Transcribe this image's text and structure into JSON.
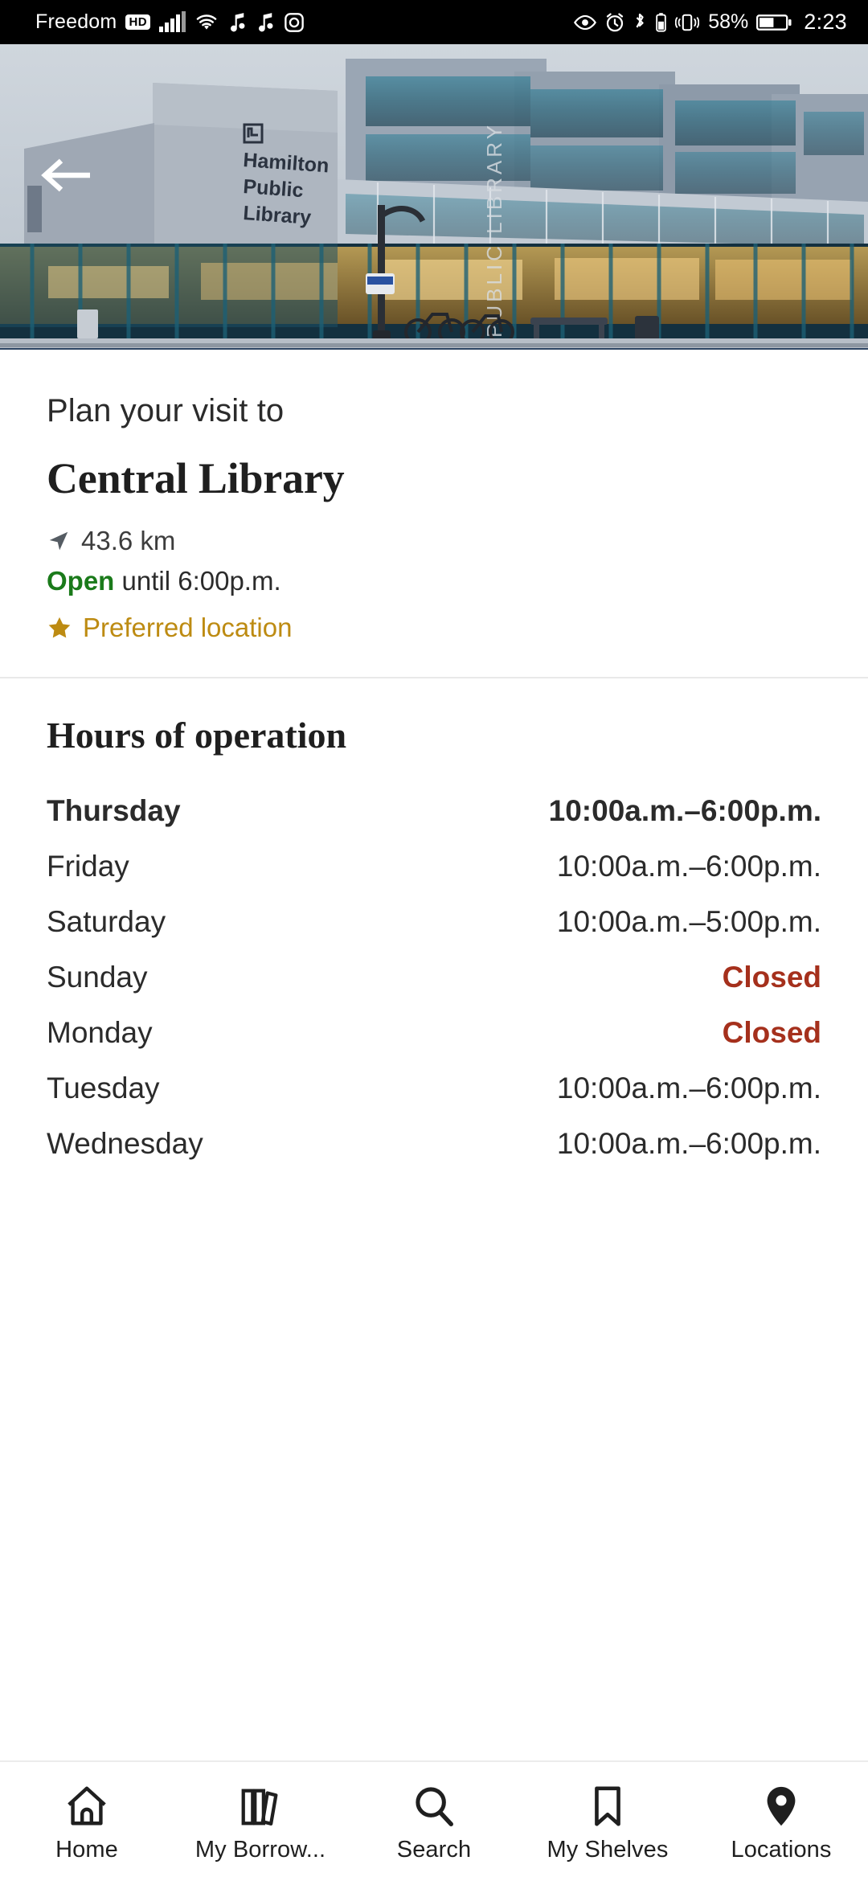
{
  "statusbar": {
    "carrier": "Freedom",
    "hd_badge": "HD",
    "battery_percent": "58%",
    "time": "2:23",
    "icons": [
      "signal-bars-icon",
      "wifi-icon",
      "music-note-icon",
      "music-note-icon",
      "instagram-icon",
      "eye-icon",
      "alarm-clock-icon",
      "bluetooth-icon",
      "vibrate-icon",
      "battery-icon"
    ]
  },
  "hero": {
    "back_icon": "back-arrow-icon",
    "building_sign": "Hamilton Public Library",
    "glass_text": "PUBLIC LIBRARY"
  },
  "info": {
    "plan_label": "Plan your visit to",
    "branch_name": "Central Library",
    "distance": "43.6 km",
    "distance_icon": "navigation-arrow-icon",
    "status_word": "Open",
    "status_rest": " until 6:00p.m.",
    "preferred_label": "Preferred location",
    "preferred_icon": "star-icon"
  },
  "hours": {
    "title": "Hours of operation",
    "rows": [
      {
        "day": "Thursday",
        "time": "10:00a.m.–6:00p.m.",
        "closed": false,
        "today": true
      },
      {
        "day": "Friday",
        "time": "10:00a.m.–6:00p.m.",
        "closed": false,
        "today": false
      },
      {
        "day": "Saturday",
        "time": "10:00a.m.–5:00p.m.",
        "closed": false,
        "today": false
      },
      {
        "day": "Sunday",
        "time": "Closed",
        "closed": true,
        "today": false
      },
      {
        "day": "Monday",
        "time": "Closed",
        "closed": true,
        "today": false
      },
      {
        "day": "Tuesday",
        "time": "10:00a.m.–6:00p.m.",
        "closed": false,
        "today": false
      },
      {
        "day": "Wednesday",
        "time": "10:00a.m.–6:00p.m.",
        "closed": false,
        "today": false
      }
    ]
  },
  "navbar": {
    "items": [
      {
        "label": "Home",
        "icon": "home-icon",
        "active": false
      },
      {
        "label": "My Borrow...",
        "icon": "books-icon",
        "active": false
      },
      {
        "label": "Search",
        "icon": "search-icon",
        "active": false
      },
      {
        "label": "My Shelves",
        "icon": "bookmark-icon",
        "active": false
      },
      {
        "label": "Locations",
        "icon": "location-pin-icon",
        "active": true
      }
    ]
  },
  "colors": {
    "open_green": "#1a7a1a",
    "closed_red": "#a5301c",
    "preferred_gold": "#bd8b12",
    "text_dark": "#2b2b2b",
    "divider": "#e9e9e9"
  }
}
